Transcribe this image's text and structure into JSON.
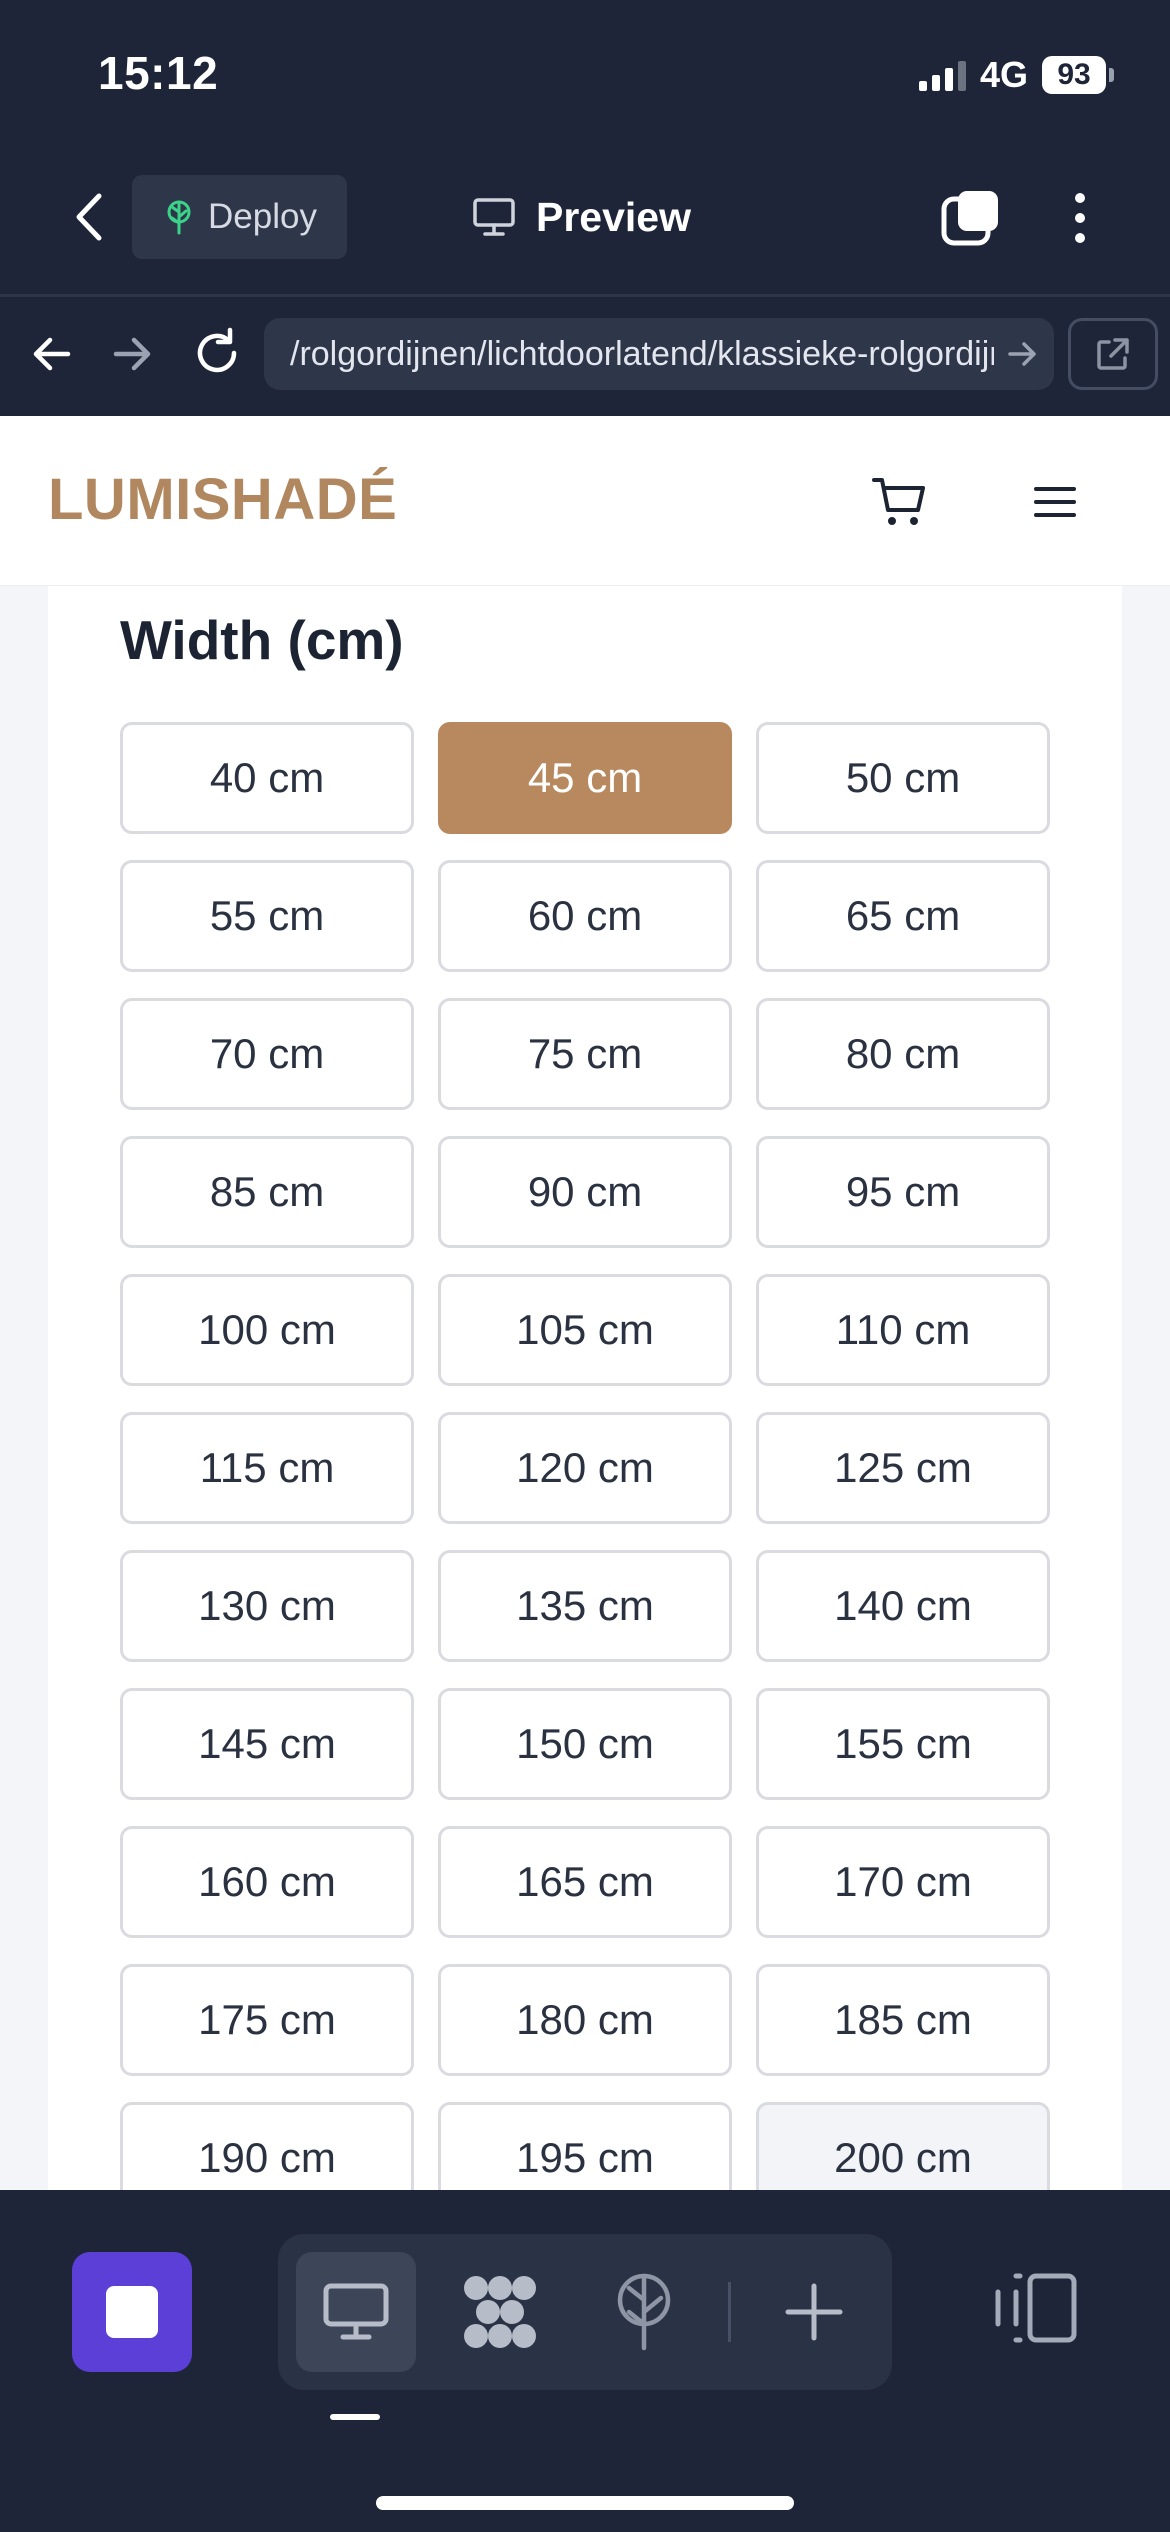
{
  "status_bar": {
    "time": "15:12",
    "network": "4G",
    "battery": "93"
  },
  "toolbar": {
    "deploy_label": "Deploy",
    "preview_label": "Preview"
  },
  "browser": {
    "url": "/rolgordijnen/lichtdoorlatend/klassieke-rolgordijn"
  },
  "site": {
    "logo": "LUMISHADÉ"
  },
  "width_section": {
    "title": "Width (cm)",
    "selected": "45 cm",
    "options": [
      "40 cm",
      "45 cm",
      "50 cm",
      "55 cm",
      "60 cm",
      "65 cm",
      "70 cm",
      "75 cm",
      "80 cm",
      "85 cm",
      "90 cm",
      "95 cm",
      "100 cm",
      "105 cm",
      "110 cm",
      "115 cm",
      "120 cm",
      "125 cm",
      "130 cm",
      "135 cm",
      "140 cm",
      "145 cm",
      "150 cm",
      "155 cm",
      "160 cm",
      "165 cm",
      "170 cm",
      "175 cm",
      "180 cm",
      "185 cm",
      "190 cm",
      "195 cm",
      "200 cm"
    ]
  },
  "colors": {
    "brand": "#b0875f",
    "selected_option": "#b8895f",
    "chrome_bg": "#1e2538",
    "stop_button": "#5b3fd6"
  },
  "icons": {
    "toolbar": [
      "back-chevron-icon",
      "deploy-tree-icon",
      "monitor-icon",
      "tabs-icon",
      "more-vertical-icon"
    ],
    "nav": [
      "arrow-left-icon",
      "arrow-right-icon",
      "reload-icon",
      "url-go-arrow-icon",
      "external-link-icon"
    ],
    "site": [
      "cart-icon",
      "hamburger-menu-icon"
    ],
    "bottom": [
      "stop-icon",
      "desktop-view-icon",
      "components-icon",
      "deploy-icon",
      "plus-icon",
      "panel-toggle-icon"
    ]
  }
}
